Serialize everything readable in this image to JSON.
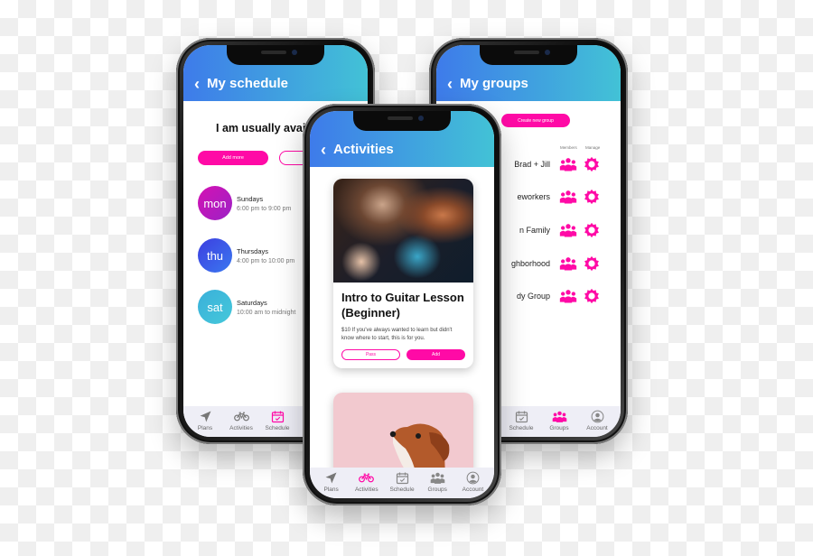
{
  "background": "transparent-checkerboard",
  "colors": {
    "accent": "#ff0aa6",
    "header_gradient_start": "#3e7bea",
    "header_gradient_end": "#42c2d6",
    "tabbar": "#eeeef6"
  },
  "schedule_screen": {
    "header": {
      "back_icon": "chevron-left-icon",
      "title": "My schedule"
    },
    "heading": "I am usually availa",
    "buttons": {
      "add_more": "Add more",
      "second": ""
    },
    "items": [
      {
        "abbr": "mon",
        "day": "Sundays",
        "time": "6:00 pm to 9:00 pm",
        "color_start": "#d511b3",
        "color_end": "#9b22c6"
      },
      {
        "abbr": "thu",
        "day": "Thursdays",
        "time": "4:00 pm to 10:00 pm",
        "color_start": "#3d3ee0",
        "color_end": "#3a78f0"
      },
      {
        "abbr": "sat",
        "day": "Saturdays",
        "time": "10:00 am to midnight",
        "color_start": "#3ab0da",
        "color_end": "#45c8da"
      }
    ],
    "tabbar": [
      {
        "label": "Plans",
        "icon": "navigation-arrow-icon",
        "active": false
      },
      {
        "label": "Activities",
        "icon": "bicycle-icon",
        "active": false
      },
      {
        "label": "Schedule",
        "icon": "calendar-check-icon",
        "active": true
      }
    ]
  },
  "groups_screen": {
    "header": {
      "back_icon": "chevron-left-icon",
      "title": "My groups"
    },
    "create_button": "Create new group",
    "columns": {
      "members": "Members",
      "manage": "Manage"
    },
    "groups": [
      {
        "name": "Brad + Jill"
      },
      {
        "name": "eworkers"
      },
      {
        "name": "n Family"
      },
      {
        "name": "ghborhood"
      },
      {
        "name": "dy Group"
      }
    ],
    "tabbar": [
      {
        "label": "Schedule",
        "icon": "calendar-check-icon",
        "active": false
      },
      {
        "label": "Groups",
        "icon": "group-icon",
        "active": true
      },
      {
        "label": "Account",
        "icon": "account-icon",
        "active": false
      }
    ]
  },
  "activities_screen": {
    "header": {
      "back_icon": "chevron-left-icon",
      "title": "Activities"
    },
    "cards": [
      {
        "image": "guitar-player-photo",
        "title": "Intro to Guitar Lesson (Beginner)",
        "description": "$10 If you've always wanted to learn but didn't know where to start, this is for you.",
        "pass_label": "Pass",
        "add_label": "Add"
      },
      {
        "image": "dog-photo"
      }
    ],
    "tabbar": [
      {
        "label": "Plans",
        "icon": "navigation-arrow-icon",
        "active": false
      },
      {
        "label": "Activities",
        "icon": "bicycle-icon",
        "active": true
      },
      {
        "label": "Schedule",
        "icon": "calendar-check-icon",
        "active": false
      },
      {
        "label": "Groups",
        "icon": "group-icon",
        "active": false
      },
      {
        "label": "Account",
        "icon": "account-icon",
        "active": false
      }
    ]
  }
}
